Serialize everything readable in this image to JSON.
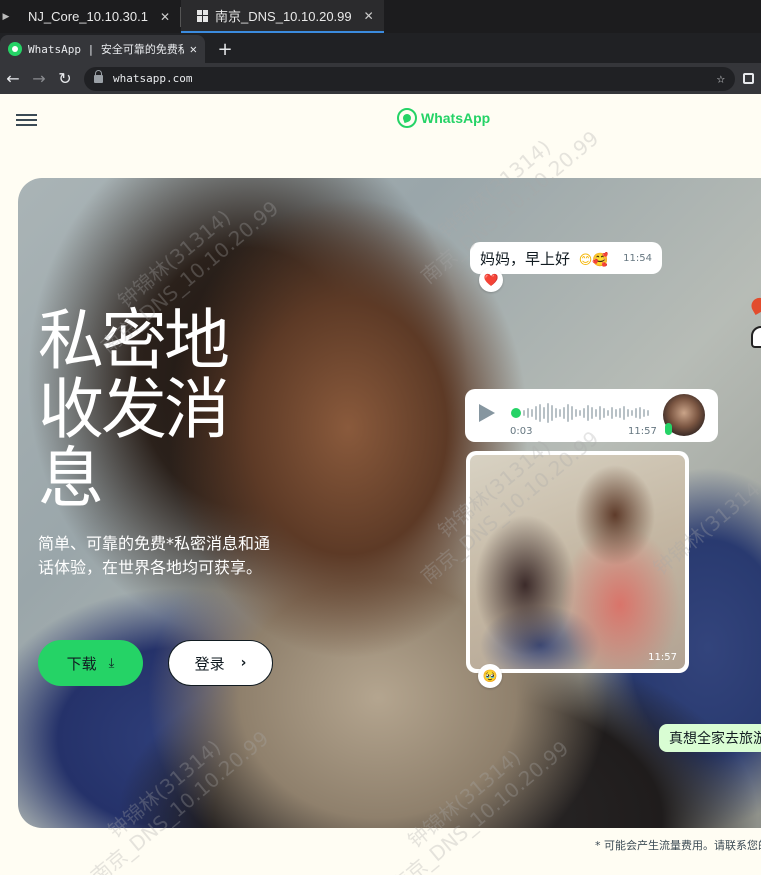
{
  "session_tabs": [
    {
      "label": "NJ_Core_10.10.30.1",
      "active": false
    },
    {
      "label": "南京_DNS_10.10.20.99",
      "active": true
    }
  ],
  "browser": {
    "tab_title": "WhatsApp | 安全可靠的免费私密...",
    "url": "whatsapp.com"
  },
  "header": {
    "brand": "WhatsApp"
  },
  "hero": {
    "title": "私密地收发消息",
    "subtitle": "简单、可靠的免费*私密消息和通话体验，在世界各地均可获享。",
    "download_label": "下载",
    "login_label": "登录"
  },
  "chat": {
    "text_message": "妈妈，早上好",
    "text_emoji": "😊🥰",
    "text_time": "11:54",
    "text_reaction": "❤️",
    "voice_elapsed": "0:03",
    "voice_time": "11:57",
    "photo_time": "11:57",
    "photo_reaction": "🥹",
    "family_message": "真想全家去旅游"
  },
  "footnote": "* 可能会产生流量费用。请联系您的",
  "watermark": {
    "line1": "钟锦林(31314)",
    "line2": "南京_DNS_10.10.20.99"
  },
  "colors": {
    "brand_green": "#25d366",
    "page_bg": "#fffdf3",
    "bubble_green": "#d9fdd3"
  }
}
